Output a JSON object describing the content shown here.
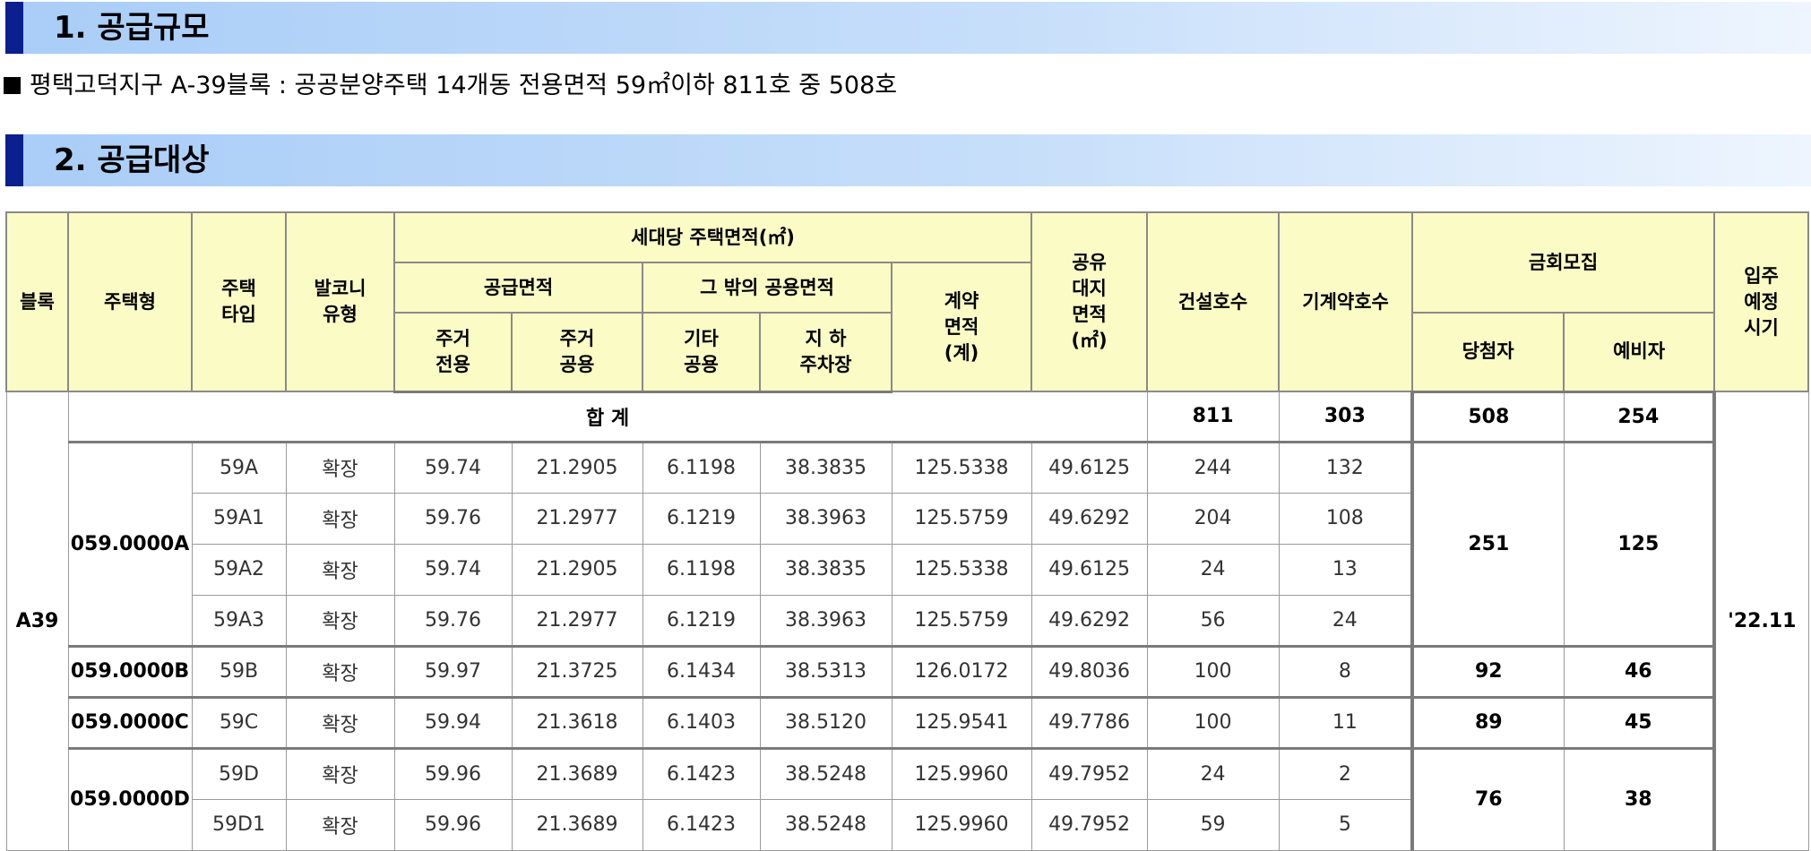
{
  "sections": {
    "supply_scale_title": "1. 공급규모",
    "supply_target_title": "2. 공급대상"
  },
  "note": "평택고덕지구 A-39블록 : 공공분양주택 14개동 전용면적 59㎡이하 811호 중 508호",
  "headers": {
    "block": "블록",
    "house_model": "주택형",
    "house_type": "주택\n타입",
    "balcony": "발코니\n유형",
    "area_group": "세대당 주택면적(㎡)",
    "supply_area": "공급면적",
    "other_common": "그 밖의 공용면적",
    "contract_area": "계약\n면적\n(계)",
    "land_area": "공유\n대지\n면적\n(㎡)",
    "built_units": "건설호수",
    "pre_contracted": "기계약호수",
    "recruit_group": "금회모집",
    "winners": "당첨자",
    "reserves": "예비자",
    "move_in": "입주\n예정\n시기",
    "residential_exclusive": "주거\n전용",
    "residential_common": "주거\n공용",
    "other_common_sub": "기타\n공용",
    "underground_parking": "지  하\n주차장"
  },
  "summary": {
    "label": "합 계",
    "built": "811",
    "pre": "303",
    "winners": "508",
    "reserves": "254"
  },
  "block": "A39",
  "move_in": "'22.11",
  "rows": [
    {
      "model": "059.0000A",
      "type": "59A",
      "balcony": "확장",
      "excl": "59.74",
      "comm": "21.2905",
      "other": "6.1198",
      "parking": "38.3835",
      "contract": "125.5338",
      "land": "49.6125",
      "built": "244",
      "pre": "132"
    },
    {
      "model": "",
      "type": "59A1",
      "balcony": "확장",
      "excl": "59.76",
      "comm": "21.2977",
      "other": "6.1219",
      "parking": "38.3963",
      "contract": "125.5759",
      "land": "49.6292",
      "built": "204",
      "pre": "108"
    },
    {
      "model": "",
      "type": "59A2",
      "balcony": "확장",
      "excl": "59.74",
      "comm": "21.2905",
      "other": "6.1198",
      "parking": "38.3835",
      "contract": "125.5338",
      "land": "49.6125",
      "built": "24",
      "pre": "13"
    },
    {
      "model": "",
      "type": "59A3",
      "balcony": "확장",
      "excl": "59.76",
      "comm": "21.2977",
      "other": "6.1219",
      "parking": "38.3963",
      "contract": "125.5759",
      "land": "49.6292",
      "built": "56",
      "pre": "24"
    },
    {
      "model": "059.0000B",
      "type": "59B",
      "balcony": "확장",
      "excl": "59.97",
      "comm": "21.3725",
      "other": "6.1434",
      "parking": "38.5313",
      "contract": "126.0172",
      "land": "49.8036",
      "built": "100",
      "pre": "8"
    },
    {
      "model": "059.0000C",
      "type": "59C",
      "balcony": "확장",
      "excl": "59.94",
      "comm": "21.3618",
      "other": "6.1403",
      "parking": "38.5120",
      "contract": "125.9541",
      "land": "49.7786",
      "built": "100",
      "pre": "11"
    },
    {
      "model": "059.0000D",
      "type": "59D",
      "balcony": "확장",
      "excl": "59.96",
      "comm": "21.3689",
      "other": "6.1423",
      "parking": "38.5248",
      "contract": "125.9960",
      "land": "49.7952",
      "built": "24",
      "pre": "2"
    },
    {
      "model": "",
      "type": "59D1",
      "balcony": "확장",
      "excl": "59.96",
      "comm": "21.3689",
      "other": "6.1423",
      "parking": "38.5248",
      "contract": "125.9960",
      "land": "49.7952",
      "built": "59",
      "pre": "5"
    }
  ],
  "groups": [
    {
      "model": "059.0000A",
      "winners": "251",
      "reserves": "125"
    },
    {
      "model": "059.0000B",
      "winners": "92",
      "reserves": "46"
    },
    {
      "model": "059.0000C",
      "winners": "89",
      "reserves": "45"
    },
    {
      "model": "059.0000D",
      "winners": "76",
      "reserves": "38"
    }
  ]
}
